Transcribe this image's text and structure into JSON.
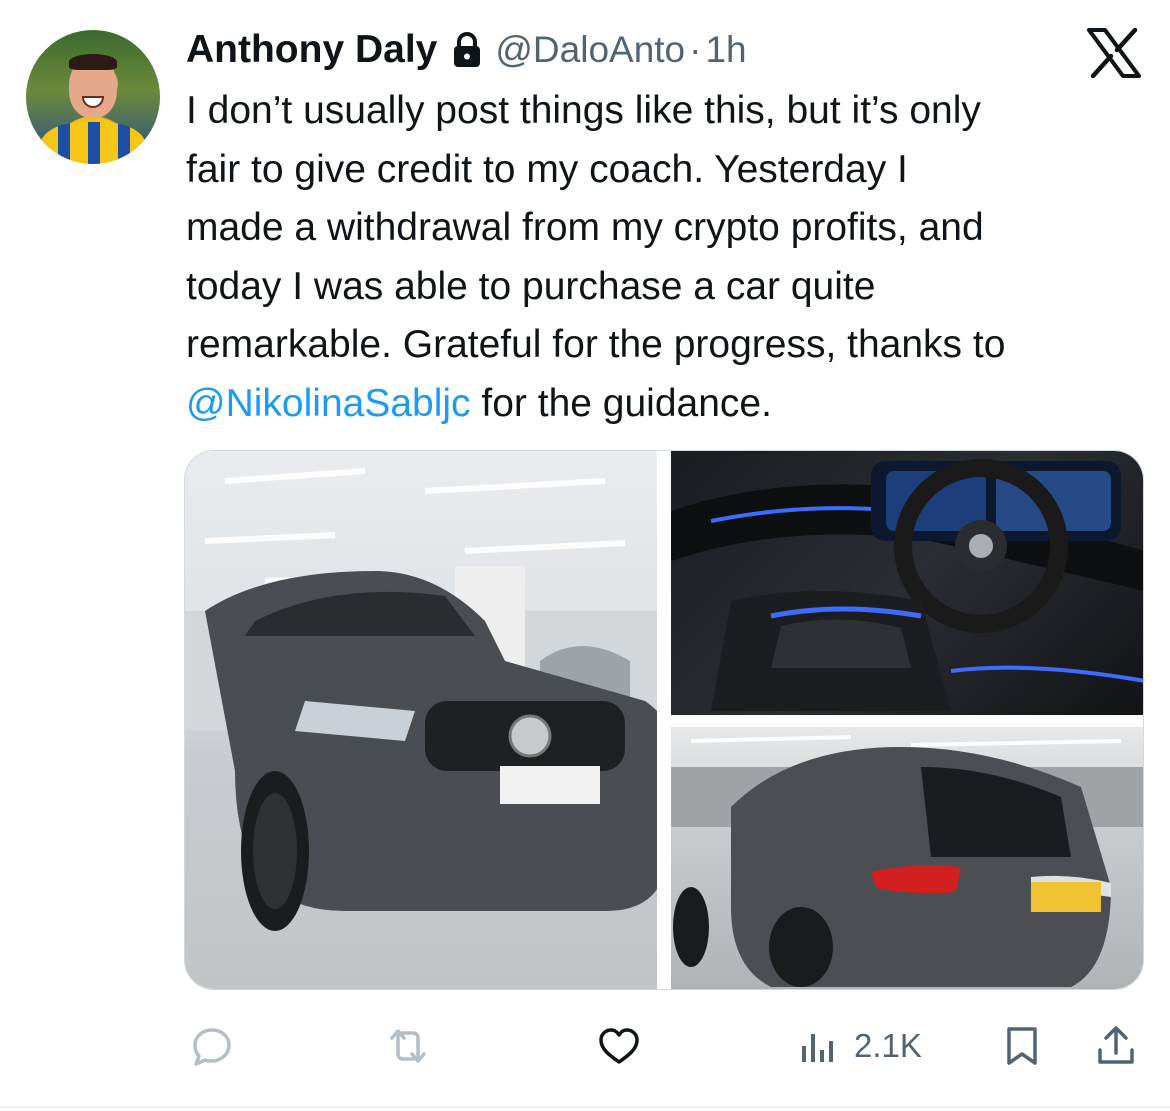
{
  "tweet": {
    "author_name": "Anthony Daly",
    "handle": "@DaloAnto",
    "separator": "·",
    "time": "1h",
    "lines": [
      "I don’t usually post things like this, but it’s only",
      "fair to give credit to my coach. Yesterday I",
      "made a withdrawal from my crypto profits, and",
      "today I was able to purchase a car quite",
      "remarkable. Grateful for the progress, thanks to"
    ],
    "mention": "@NikolinaSabljc",
    "last_line_tail": " for the guidance."
  },
  "icons": {
    "lock": "lock-icon",
    "x_logo": "x-logo-icon",
    "reply": "reply-icon",
    "retweet": "retweet-icon",
    "like": "heart-icon",
    "views": "views-icon",
    "bookmark": "bookmark-icon",
    "share": "share-icon"
  },
  "actions": {
    "views_count": "2.1K"
  },
  "colors": {
    "link": "#1d9bf0",
    "secondary_text": "#536471",
    "primary_text": "#0f1419"
  }
}
